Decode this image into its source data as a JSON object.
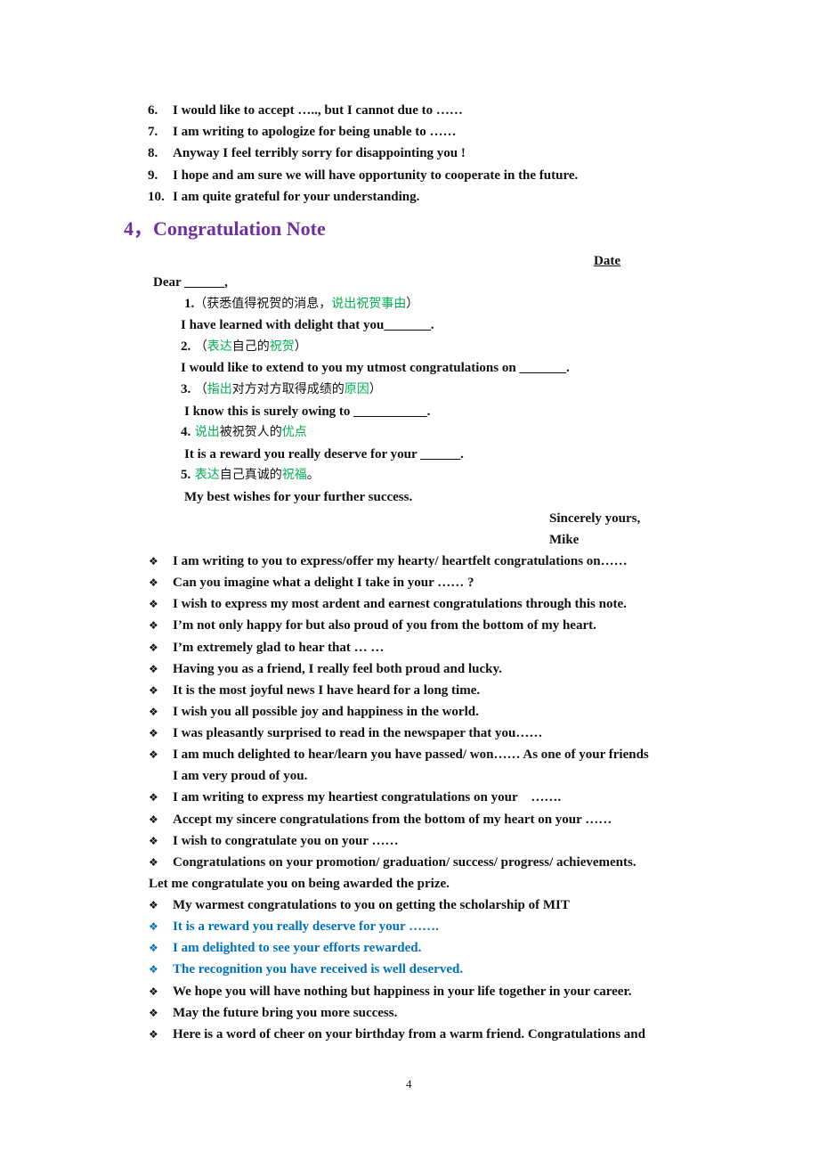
{
  "numbered_list": [
    {
      "num": "6.",
      "text": "I would like to accept ….., but I cannot due to ……"
    },
    {
      "num": "7.",
      "text": "I am writing to apologize for being unable to ……"
    },
    {
      "num": "8.",
      "text": "Anyway I feel terribly sorry for disappointing you !"
    },
    {
      "num": "9.",
      "text": "I hope and am sure we will have opportunity to cooperate in the future."
    },
    {
      "num": "10.",
      "text": "I am quite grateful for your understanding."
    }
  ],
  "section": {
    "heading": "4，Congratulation Note",
    "date_label": "Date",
    "salutation": "Dear ______,",
    "steps": [
      {
        "num": "1.",
        "cn_parts": [
          {
            "t": "（获悉值得祝贺的消息，",
            "c": ""
          },
          {
            "t": "说出祝贺事由",
            "c": "green"
          },
          {
            "t": "）",
            "c": ""
          }
        ],
        "en_text": "I have learned with delight that you",
        "en_blank": "_______."
      },
      {
        "num": "2.",
        "cn_parts": [
          {
            "t": " （",
            "c": ""
          },
          {
            "t": "表达",
            "c": "green"
          },
          {
            "t": "自己的",
            "c": ""
          },
          {
            "t": "祝贺",
            "c": "green"
          },
          {
            "t": "）",
            "c": ""
          }
        ],
        "en_text": "I would like to extend to you my utmost congratulations on ",
        "en_blank": "_______."
      },
      {
        "num": "3.",
        "cn_parts": [
          {
            "t": " （",
            "c": ""
          },
          {
            "t": "指出",
            "c": "green"
          },
          {
            "t": "对方对方取得成绩的",
            "c": ""
          },
          {
            "t": "原因",
            "c": "green"
          },
          {
            "t": "）",
            "c": ""
          }
        ],
        "en_text": "I know this is surely owing to ___________.",
        "en_blank": ""
      },
      {
        "num": "4.",
        "cn_parts": [
          {
            "t": " ",
            "c": ""
          },
          {
            "t": "说出",
            "c": "green"
          },
          {
            "t": "被祝贺人的",
            "c": ""
          },
          {
            "t": "优点",
            "c": "green"
          }
        ],
        "en_text": "It is a reward you really deserve for your ______.",
        "en_blank": ""
      },
      {
        "num": "5.",
        "cn_parts": [
          {
            "t": " ",
            "c": ""
          },
          {
            "t": "表达",
            "c": "green"
          },
          {
            "t": "自己真诚的",
            "c": ""
          },
          {
            "t": "祝福",
            "c": "green"
          },
          {
            "t": "。",
            "c": ""
          }
        ],
        "en_text": "My best wishes for your further success.",
        "en_blank": ""
      }
    ],
    "closing": "Sincerely yours,",
    "signature": "Mike"
  },
  "bullets": [
    {
      "text": "I am writing to you to express/offer my hearty/ heartfelt congratulations on……",
      "color": "black",
      "bullet": true
    },
    {
      "text": "Can you imagine what a delight I take in your …… ?",
      "color": "black",
      "bullet": true
    },
    {
      "text": "I wish to express my most ardent and earnest congratulations through this note.",
      "color": "black",
      "bullet": true
    },
    {
      "text": "I’m not only happy for but also proud of you from the bottom of my heart.",
      "color": "black",
      "bullet": true
    },
    {
      "text": "I’m extremely glad to hear that … …",
      "color": "black",
      "bullet": true
    },
    {
      "text": "Having you as a friend, I really feel both proud and lucky.",
      "color": "black",
      "bullet": true
    },
    {
      "text": "It is the most joyful news I have heard for a long time.",
      "color": "black",
      "bullet": true
    },
    {
      "text": "I wish you all possible joy and happiness in the world.",
      "color": "black",
      "bullet": true
    },
    {
      "text": "I was pleasantly surprised to read in the newspaper that you……",
      "color": "black",
      "bullet": true
    },
    {
      "text": "I am much delighted to hear/learn you have passed/ won…… As one of your friends",
      "color": "black",
      "bullet": true
    },
    {
      "text": "I am very proud of you.",
      "color": "black",
      "bullet": false,
      "continuation": true
    },
    {
      "text": "I am writing to express my heartiest congratulations on your    …….",
      "color": "black",
      "bullet": true
    },
    {
      "text": "Accept my sincere congratulations from the bottom of my heart on your ……",
      "color": "black",
      "bullet": true
    },
    {
      "text": "I wish to congratulate you on your ……",
      "color": "black",
      "bullet": true
    },
    {
      "text": "Congratulations on your promotion/ graduation/ success/ progress/ achievements.",
      "color": "black",
      "bullet": true
    },
    {
      "text": "Let me congratulate you on being awarded the prize.",
      "color": "black",
      "bullet": false,
      "continuation": false
    },
    {
      "text": "My warmest congratulations to you on getting the scholarship of MIT",
      "color": "black",
      "bullet": true
    },
    {
      "text": "It is a reward you really deserve for your …….",
      "color": "blue",
      "bullet": true
    },
    {
      "text": "I am delighted to see your efforts rewarded.",
      "color": "blue",
      "bullet": true
    },
    {
      "text": "The recognition you have received is well deserved.",
      "color": "blue",
      "bullet": true
    },
    {
      "text": "We hope you will have nothing but happiness in your life together in your career.",
      "color": "black",
      "bullet": true
    },
    {
      "text": "May the future bring you more success.",
      "color": "black",
      "bullet": true
    },
    {
      "text": "Here is a word of cheer on your birthday from a warm friend. Congratulations and",
      "color": "black",
      "bullet": true
    }
  ],
  "bullet_glyph": "❖",
  "colors": {
    "heading": "#7030a0",
    "green": "#00b050",
    "blue": "#0070c0"
  },
  "page_number": "4"
}
